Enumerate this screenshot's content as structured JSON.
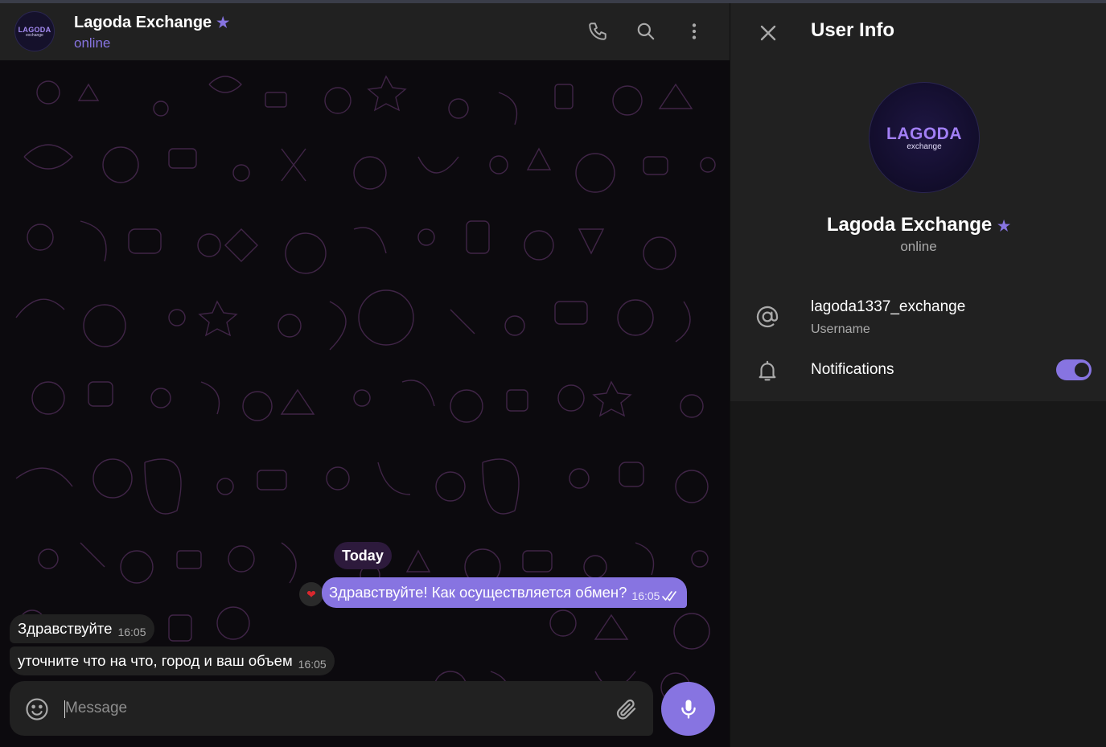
{
  "chat": {
    "header": {
      "avatar_line1": "LAGODA",
      "avatar_line2": "exchange",
      "name": "Lagoda Exchange",
      "status": "online",
      "icons": [
        "phone-icon",
        "search-icon",
        "more-vertical-icon"
      ]
    },
    "date_separator": "Today",
    "messages": [
      {
        "direction": "outgoing",
        "text": "Здравствуйте! Как осуществляется обмен?",
        "time": "16:05",
        "read": true,
        "reaction": "heart"
      },
      {
        "direction": "incoming",
        "text": "Здравствуйте",
        "time": "16:05"
      },
      {
        "direction": "incoming",
        "text": "уточните что на что, город и ваш объем",
        "time": "16:05"
      }
    ],
    "composer": {
      "placeholder": "Message",
      "value": ""
    }
  },
  "user_info": {
    "title": "User Info",
    "avatar_line1": "LAGODA",
    "avatar_line2": "exchange",
    "name": "Lagoda Exchange",
    "status": "online",
    "username": "lagoda1337_exchange",
    "username_label": "Username",
    "notifications_label": "Notifications",
    "notifications_enabled": true
  },
  "colors": {
    "accent": "#8774e1",
    "panel": "#212121",
    "chat_background": "#0c0a0e",
    "pattern": "#4a2a52"
  }
}
